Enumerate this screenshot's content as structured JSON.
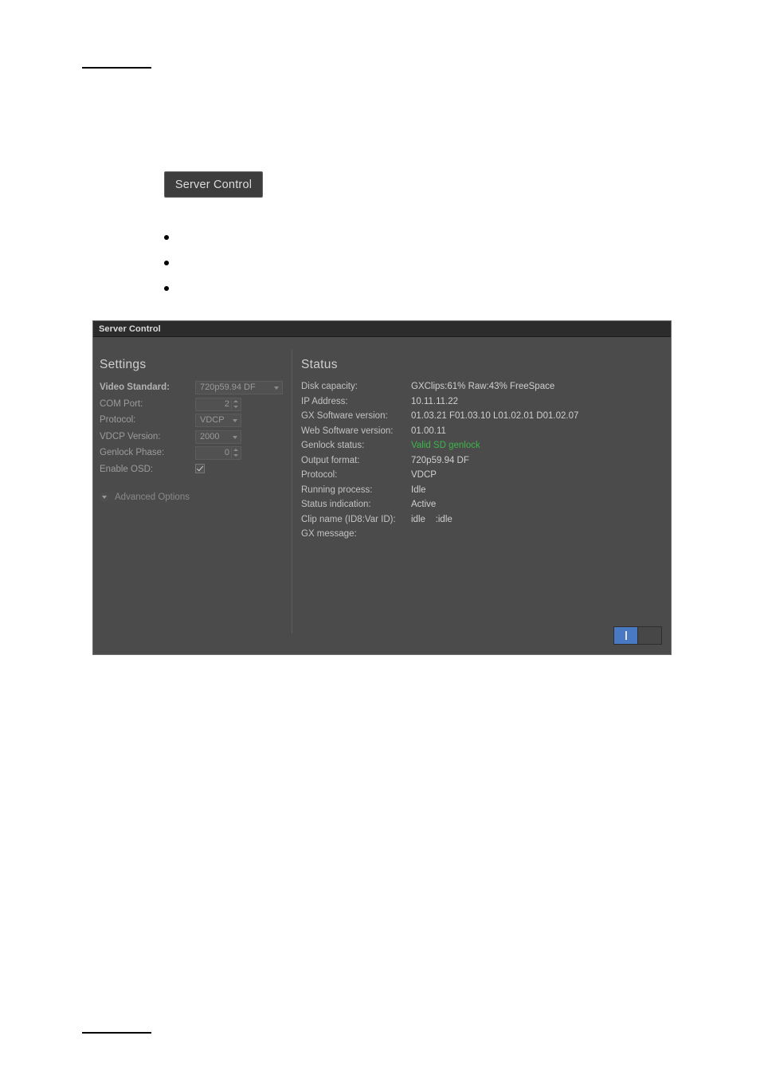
{
  "document": {
    "rule_top": "",
    "rule_bottom": ""
  },
  "chip_button": {
    "label": "Server Control"
  },
  "bullets": [
    {
      "text": ""
    },
    {
      "text": ""
    },
    {
      "text": ""
    }
  ],
  "panel": {
    "title": "Server Control",
    "settings": {
      "heading": "Settings",
      "rows": [
        {
          "label": "Video Standard:",
          "value": "720p59.94 DF",
          "control": "dropdown-wide"
        },
        {
          "label": "COM Port:",
          "value": "2",
          "control": "spinner"
        },
        {
          "label": "Protocol:",
          "value": "VDCP",
          "control": "dropdown-narrow"
        },
        {
          "label": "VDCP Version:",
          "value": "2000",
          "control": "dropdown-narrow"
        },
        {
          "label": "Genlock Phase:",
          "value": "0",
          "control": "spinner"
        },
        {
          "label": "Enable OSD:",
          "value": "checked",
          "control": "checkbox"
        }
      ],
      "advanced_options_label": "Advanced Options"
    },
    "status": {
      "heading": "Status",
      "rows": [
        {
          "label": "Disk capacity:",
          "value": "GXClips:61% Raw:43% FreeSpace"
        },
        {
          "label": "IP Address:",
          "value": "10.11.11.22"
        },
        {
          "label": "GX Software version:",
          "value": "01.03.21 F01.03.10 L01.02.01 D01.02.07"
        },
        {
          "label": "Web Software version:",
          "value": "01.00.11"
        },
        {
          "label": "Genlock status:",
          "value": "Valid SD genlock",
          "highlight": "green"
        },
        {
          "label": "Output format:",
          "value": "720p59.94 DF"
        },
        {
          "label": "Protocol:",
          "value": "VDCP"
        },
        {
          "label": "Running process:",
          "value": "Idle"
        },
        {
          "label": "Status indication:",
          "value": "Active"
        },
        {
          "label": "Clip name (ID8:Var ID):",
          "value": "idle    :idle"
        },
        {
          "label": "GX message:",
          "value": ""
        }
      ]
    },
    "power_toggle": {
      "on_label": "I",
      "off_label": ""
    }
  },
  "colors": {
    "panel_background": "#4b4b4b",
    "titlebar_background": "#2c2c2c",
    "genlock_green": "#3cb54a",
    "toggle_on_blue": "#4a79c4",
    "chip_background": "#3d3d3d"
  }
}
